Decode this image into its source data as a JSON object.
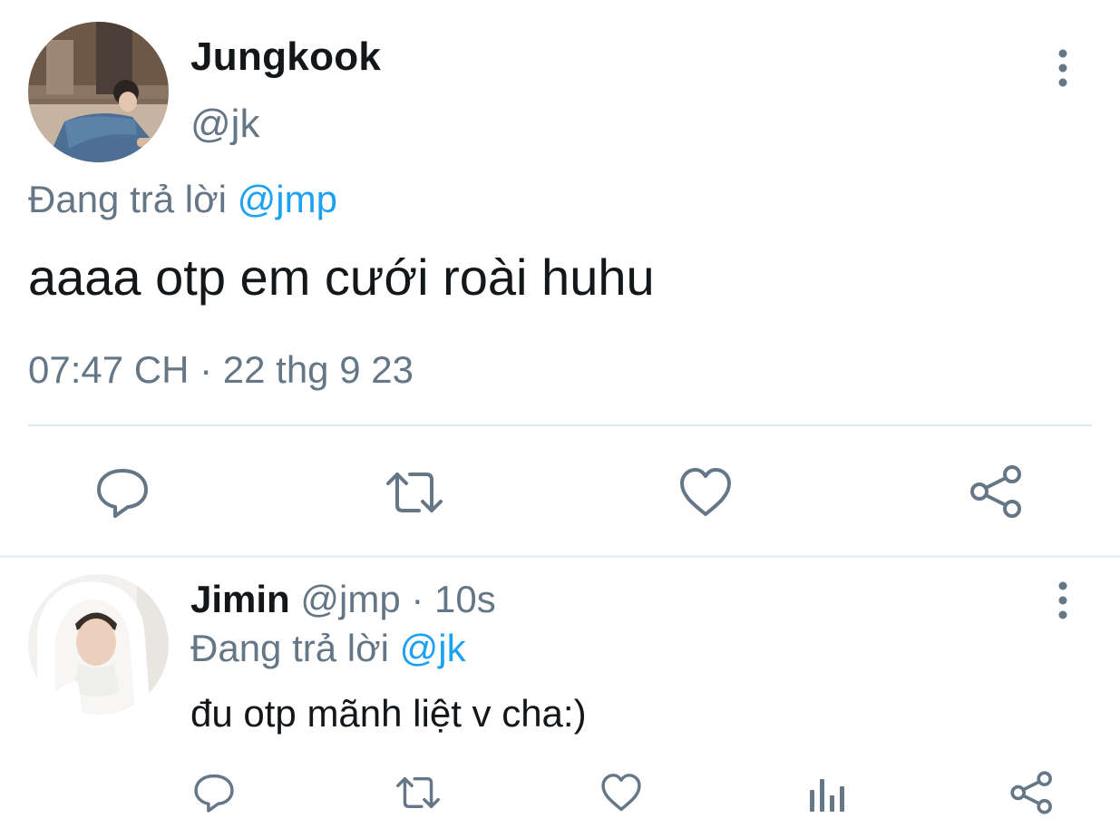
{
  "main_tweet": {
    "display_name": "Jungkook",
    "handle": "@jk",
    "replying_prefix": "Đang trả lời ",
    "replying_to": "@jmp",
    "text": "aaaa otp em cưới roài huhu",
    "time": "07:47 CH",
    "separator": " · ",
    "date": "22 thg 9 23",
    "actions": [
      "reply-icon",
      "retweet-icon",
      "like-icon",
      "share-icon"
    ]
  },
  "reply_tweet": {
    "display_name": "Jimin",
    "handle": "@jmp",
    "separator": " · ",
    "age": "10s",
    "replying_prefix": "Đang trả lời ",
    "replying_to": "@jk",
    "text": "đu otp mãnh liệt v cha:)",
    "actions": [
      "reply-icon",
      "retweet-icon",
      "like-icon",
      "stats-icon",
      "share-icon"
    ]
  },
  "colors": {
    "text_primary": "#14171a",
    "text_secondary": "#657786",
    "mention": "#1da1f2",
    "divider": "#e1e8ed"
  }
}
